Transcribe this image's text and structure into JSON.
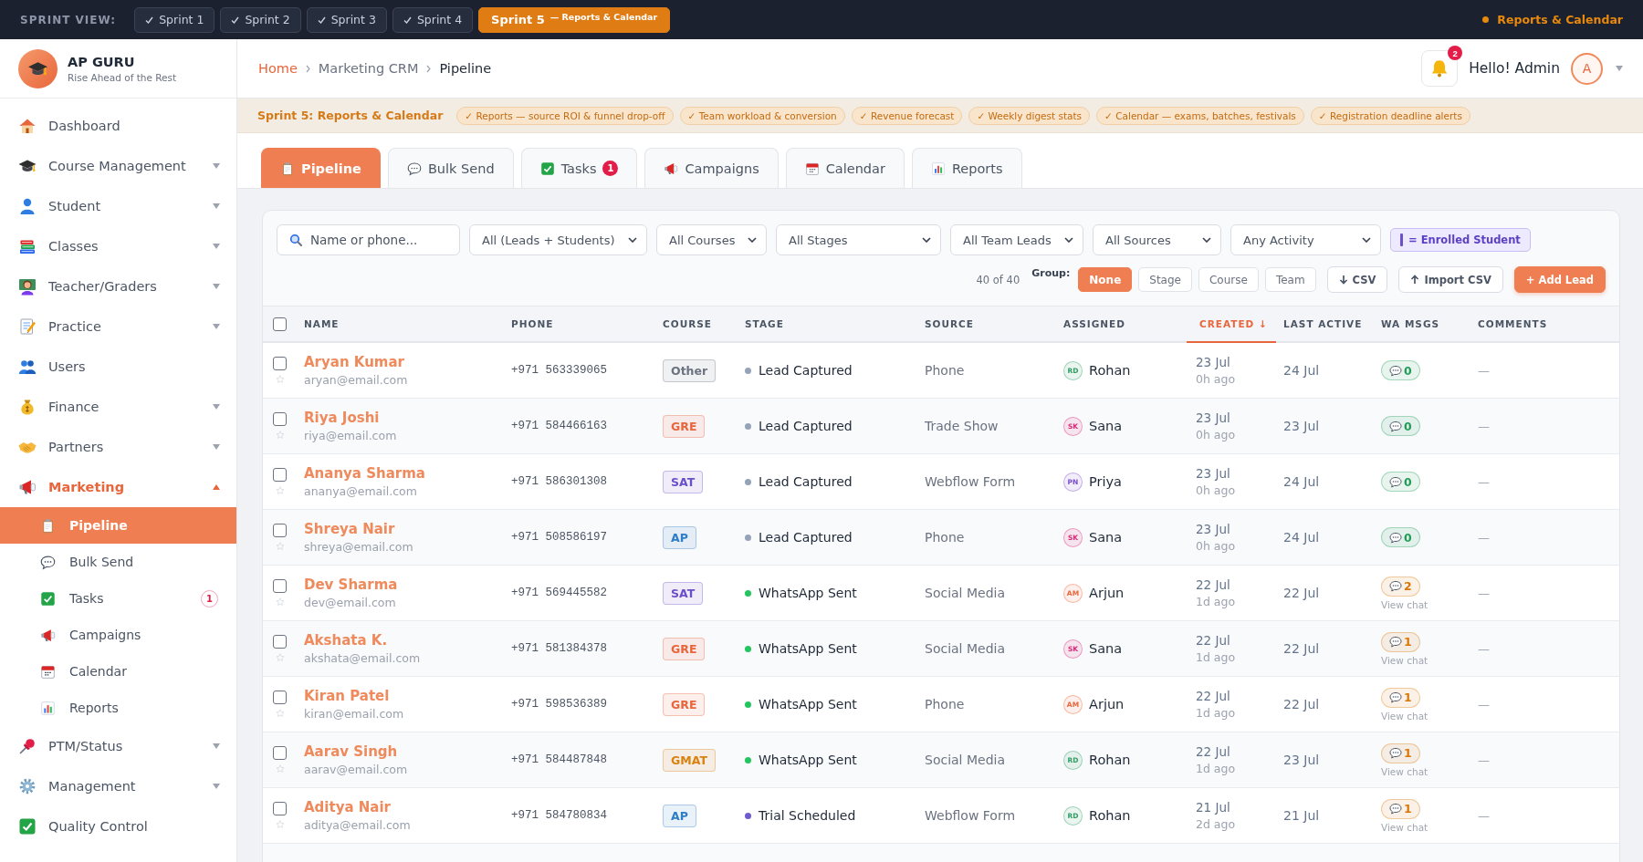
{
  "sprint_bar": {
    "label": "SPRINT VIEW:",
    "sprints": [
      {
        "label": "Sprint 1",
        "done": true,
        "selected": false
      },
      {
        "label": "Sprint 2",
        "done": true,
        "selected": false
      },
      {
        "label": "Sprint 3",
        "done": true,
        "selected": false
      },
      {
        "label": "Sprint 4",
        "done": true,
        "selected": false
      },
      {
        "label": "Sprint 5",
        "subtitle": "— Reports & Calendar",
        "done": false,
        "selected": true
      }
    ],
    "current": "Reports & Calendar"
  },
  "brand": {
    "name": "AP GURU",
    "tagline": "Rise Ahead of the Rest"
  },
  "sidebar": {
    "items": [
      {
        "label": "Dashboard",
        "selected": false
      },
      {
        "label": "Course Management",
        "selected": false,
        "expanded": false
      },
      {
        "label": "Student",
        "selected": false,
        "expanded": false
      },
      {
        "label": "Classes",
        "selected": false,
        "expanded": false
      },
      {
        "label": "Teacher/Graders",
        "selected": false,
        "expanded": false
      },
      {
        "label": "Practice",
        "selected": false,
        "expanded": false
      },
      {
        "label": "Users",
        "selected": false
      },
      {
        "label": "Finance",
        "selected": false,
        "expanded": false
      },
      {
        "label": "Partners",
        "selected": false,
        "expanded": false
      },
      {
        "label": "Marketing",
        "selected": true,
        "expanded": true,
        "children": [
          {
            "label": "Pipeline",
            "selected": true
          },
          {
            "label": "Bulk Send",
            "selected": false
          },
          {
            "label": "Tasks",
            "selected": false,
            "badge": "1"
          },
          {
            "label": "Campaigns",
            "selected": false
          },
          {
            "label": "Calendar",
            "selected": false
          },
          {
            "label": "Reports",
            "selected": false
          }
        ]
      },
      {
        "label": "PTM/Status",
        "selected": false,
        "expanded": false
      },
      {
        "label": "Management",
        "selected": false,
        "expanded": false
      },
      {
        "label": "Quality Control",
        "selected": false
      }
    ]
  },
  "header": {
    "breadcrumb": [
      "Home",
      "Marketing CRM",
      "Pipeline"
    ],
    "notifications": "2",
    "greeting": "Hello! Admin",
    "avatar": "A"
  },
  "banner": {
    "title": "Sprint 5: Reports & Calendar",
    "features": [
      "✓ Reports — source ROI & funnel drop-off",
      "✓ Team workload & conversion",
      "✓ Revenue forecast",
      "✓ Weekly digest stats",
      "✓ Calendar — exams, batches, festivals",
      "✓ Registration deadline alerts"
    ]
  },
  "tabs": [
    {
      "label": "Pipeline",
      "selected": true
    },
    {
      "label": "Bulk Send",
      "selected": false
    },
    {
      "label": "Tasks",
      "selected": false,
      "badge": "1"
    },
    {
      "label": "Campaigns",
      "selected": false
    },
    {
      "label": "Calendar",
      "selected": false
    },
    {
      "label": "Reports",
      "selected": false
    }
  ],
  "filters": {
    "search": {
      "placeholder": "Name or phone..."
    },
    "selects": [
      "All (Leads + Students)",
      "All Courses",
      "All Stages",
      "All Team Leads",
      "All Sources",
      "Any Activity"
    ],
    "legend": {
      "label": "= Enrolled Student",
      "color": "#6d4fc9"
    },
    "count": "40 of 40",
    "group": {
      "label": "Group:",
      "options": [
        {
          "label": "None",
          "selected": true
        },
        {
          "label": "Stage",
          "selected": false
        },
        {
          "label": "Course",
          "selected": false
        },
        {
          "label": "Team",
          "selected": false
        }
      ]
    },
    "actions": [
      {
        "label": "CSV",
        "kind": "download"
      },
      {
        "label": "Import CSV",
        "kind": "upload"
      },
      {
        "label": "+ Add Lead",
        "kind": "primary"
      }
    ]
  },
  "table": {
    "select_all": {
      "checked": false
    },
    "columns": [
      {
        "label": "NAME",
        "sorted": false
      },
      {
        "label": "PHONE",
        "sorted": false
      },
      {
        "label": "COURSE",
        "sorted": false
      },
      {
        "label": "STAGE",
        "sorted": false
      },
      {
        "label": "SOURCE",
        "sorted": false
      },
      {
        "label": "ASSIGNED",
        "sorted": false
      },
      {
        "label": "CREATED ↓",
        "sorted": true
      },
      {
        "label": "LAST ACTIVE",
        "sorted": false
      },
      {
        "label": "WA MSGS",
        "sorted": false
      },
      {
        "label": "COMMENTS",
        "sorted": false
      }
    ],
    "rows": [
      {
        "checked": false,
        "starred": false,
        "name": "Aryan Kumar",
        "email": "aryan@email.com",
        "phone": "+971 563339065",
        "course": {
          "label": "Other",
          "color": "#6b7280"
        },
        "stage": {
          "label": "Lead Captured",
          "color": "#94a3b8"
        },
        "source": "Phone",
        "assigned": {
          "initials": "RD",
          "name": "Rohan",
          "color": "#2f9e63"
        },
        "created": "23 Jul",
        "created_ago": "0h ago",
        "last_active": "24 Jul",
        "wa_msgs": {
          "count": "0",
          "color": "#1f9d55"
        },
        "comments": "—"
      },
      {
        "checked": false,
        "starred": false,
        "name": "Riya Joshi",
        "email": "riya@email.com",
        "phone": "+971 584466163",
        "course": {
          "label": "GRE",
          "color": "#e8663c"
        },
        "stage": {
          "label": "Lead Captured",
          "color": "#94a3b8"
        },
        "source": "Trade Show",
        "assigned": {
          "initials": "SK",
          "name": "Sana",
          "color": "#db2777"
        },
        "created": "23 Jul",
        "created_ago": "0h ago",
        "last_active": "23 Jul",
        "wa_msgs": {
          "count": "0",
          "color": "#1f9d55"
        },
        "comments": "—"
      },
      {
        "checked": false,
        "starred": false,
        "name": "Ananya Sharma",
        "email": "ananya@email.com",
        "phone": "+971 586301308",
        "course": {
          "label": "SAT",
          "color": "#6a4fc9"
        },
        "stage": {
          "label": "Lead Captured",
          "color": "#94a3b8"
        },
        "source": "Webflow Form",
        "assigned": {
          "initials": "PN",
          "name": "Priya",
          "color": "#7c4dcc"
        },
        "created": "23 Jul",
        "created_ago": "0h ago",
        "last_active": "24 Jul",
        "wa_msgs": {
          "count": "0",
          "color": "#1f9d55"
        },
        "comments": "—"
      },
      {
        "checked": false,
        "starred": false,
        "name": "Shreya Nair",
        "email": "shreya@email.com",
        "phone": "+971 508586197",
        "course": {
          "label": "AP",
          "color": "#2f7cc7"
        },
        "stage": {
          "label": "Lead Captured",
          "color": "#94a3b8"
        },
        "source": "Phone",
        "assigned": {
          "initials": "SK",
          "name": "Sana",
          "color": "#db2777"
        },
        "created": "23 Jul",
        "created_ago": "0h ago",
        "last_active": "24 Jul",
        "wa_msgs": {
          "count": "0",
          "color": "#1f9d55"
        },
        "comments": "—"
      },
      {
        "checked": false,
        "starred": false,
        "name": "Dev Sharma",
        "email": "dev@email.com",
        "phone": "+971 569445582",
        "course": {
          "label": "SAT",
          "color": "#6a4fc9"
        },
        "stage": {
          "label": "WhatsApp Sent",
          "color": "#22c55e"
        },
        "source": "Social Media",
        "assigned": {
          "initials": "AM",
          "name": "Arjun",
          "color": "#e8663c"
        },
        "created": "22 Jul",
        "created_ago": "1d ago",
        "last_active": "22 Jul",
        "wa_msgs": {
          "count": "2",
          "color": "#d97706"
        },
        "view_chat": "View chat",
        "comments": "—"
      },
      {
        "checked": false,
        "starred": false,
        "name": "Akshata K.",
        "email": "akshata@email.com",
        "phone": "+971 581384378",
        "course": {
          "label": "GRE",
          "color": "#e8663c"
        },
        "stage": {
          "label": "WhatsApp Sent",
          "color": "#22c55e"
        },
        "source": "Social Media",
        "assigned": {
          "initials": "SK",
          "name": "Sana",
          "color": "#db2777"
        },
        "created": "22 Jul",
        "created_ago": "1d ago",
        "last_active": "22 Jul",
        "wa_msgs": {
          "count": "1",
          "color": "#d97706"
        },
        "view_chat": "View chat",
        "comments": "—"
      },
      {
        "checked": false,
        "starred": false,
        "name": "Kiran Patel",
        "email": "kiran@email.com",
        "phone": "+971 598536389",
        "course": {
          "label": "GRE",
          "color": "#e8663c"
        },
        "stage": {
          "label": "WhatsApp Sent",
          "color": "#22c55e"
        },
        "source": "Phone",
        "assigned": {
          "initials": "AM",
          "name": "Arjun",
          "color": "#e8663c"
        },
        "created": "22 Jul",
        "created_ago": "1d ago",
        "last_active": "22 Jul",
        "wa_msgs": {
          "count": "1",
          "color": "#d97706"
        },
        "view_chat": "View chat",
        "comments": "—"
      },
      {
        "checked": false,
        "starred": false,
        "name": "Aarav Singh",
        "email": "aarav@email.com",
        "phone": "+971 584487848",
        "course": {
          "label": "GMAT",
          "color": "#d9820f"
        },
        "stage": {
          "label": "WhatsApp Sent",
          "color": "#22c55e"
        },
        "source": "Social Media",
        "assigned": {
          "initials": "RD",
          "name": "Rohan",
          "color": "#2f9e63"
        },
        "created": "22 Jul",
        "created_ago": "1d ago",
        "last_active": "23 Jul",
        "wa_msgs": {
          "count": "1",
          "color": "#d97706"
        },
        "view_chat": "View chat",
        "comments": "—"
      },
      {
        "checked": false,
        "starred": false,
        "name": "Aditya Nair",
        "email": "aditya@email.com",
        "phone": "+971 584780834",
        "course": {
          "label": "AP",
          "color": "#2f7cc7"
        },
        "stage": {
          "label": "Trial Scheduled",
          "color": "#6d5bd0"
        },
        "source": "Webflow Form",
        "assigned": {
          "initials": "RD",
          "name": "Rohan",
          "color": "#2f9e63"
        },
        "created": "21 Jul",
        "created_ago": "2d ago",
        "last_active": "21 Jul",
        "wa_msgs": {
          "count": "1",
          "color": "#d97706"
        },
        "view_chat": "View chat",
        "comments": "—"
      }
    ]
  }
}
